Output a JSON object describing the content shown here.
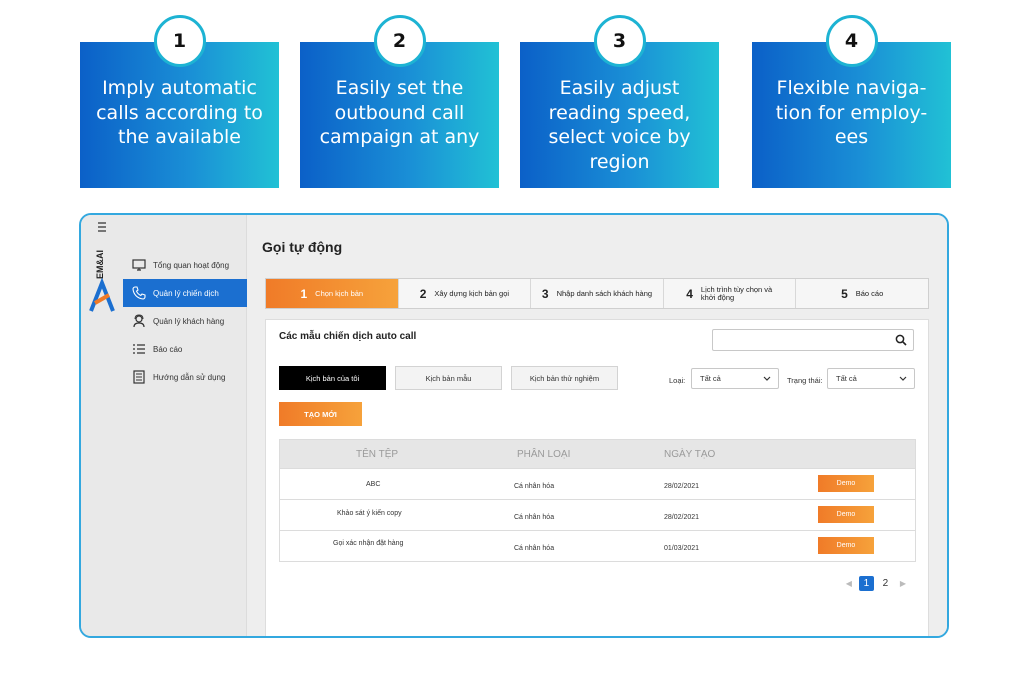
{
  "features": [
    {
      "num": "1",
      "text": "Imply automatic calls according to the available"
    },
    {
      "num": "2",
      "text": "Easily set the outbound call campaign at any"
    },
    {
      "num": "3",
      "text": "Easily adjust reading speed, select voice by region"
    },
    {
      "num": "4",
      "text": "Flexible naviga- tion for employ- ees"
    }
  ],
  "app": {
    "brand": "EM&AI",
    "sidebar": [
      {
        "label": "Tổng quan hoạt động",
        "icon": "monitor-icon"
      },
      {
        "label": "Quản lý chiến dịch",
        "icon": "phone-icon"
      },
      {
        "label": "Quản lý khách hàng",
        "icon": "user-headset-icon"
      },
      {
        "label": "Báo cáo",
        "icon": "list-icon"
      },
      {
        "label": "Hướng dẫn sử dụng",
        "icon": "document-icon"
      }
    ],
    "title": "Gọi tự động",
    "steps": [
      {
        "num": "1",
        "label": "Chọn kịch bản"
      },
      {
        "num": "2",
        "label": "Xây dựng kịch bản gọi"
      },
      {
        "num": "3",
        "label": "Nhập danh sách khách hàng"
      },
      {
        "num": "4",
        "label": "Lịch trình tùy chọn và khởi động"
      },
      {
        "num": "5",
        "label": "Báo cáo"
      }
    ],
    "panel_title": "Các mẫu chiến dịch auto call",
    "tabs": [
      "Kịch bản của tôi",
      "Kịch bản mẫu",
      "Kịch bản thử nghiệm"
    ],
    "filters": {
      "type_label": "Loại:",
      "type_value": "Tất cả",
      "status_label": "Trạng thái:",
      "status_value": "Tất cả"
    },
    "create_label": "TẠO MỚI",
    "table": {
      "headers": [
        "TÊN TỆP",
        "PHÂN LOẠI",
        "NGÀY TẠO"
      ],
      "rows": [
        {
          "name": "ABC",
          "type": "Cá nhân hóa",
          "date": "28/02/2021",
          "action": "Demo"
        },
        {
          "name": "Khảo sát ý kiến copy",
          "type": "Cá nhân hóa",
          "date": "28/02/2021",
          "action": "Demo"
        },
        {
          "name": "Gọi xác nhận đặt hàng",
          "type": "Cá nhân hóa",
          "date": "01/03/2021",
          "action": "Demo"
        }
      ]
    },
    "pagination": {
      "pages": [
        "1",
        "2"
      ],
      "current": "1"
    },
    "colors": {
      "accent_blue": "#1b6fd0",
      "accent_orange": "#f07b28",
      "frame_border": "#33a8df"
    }
  }
}
